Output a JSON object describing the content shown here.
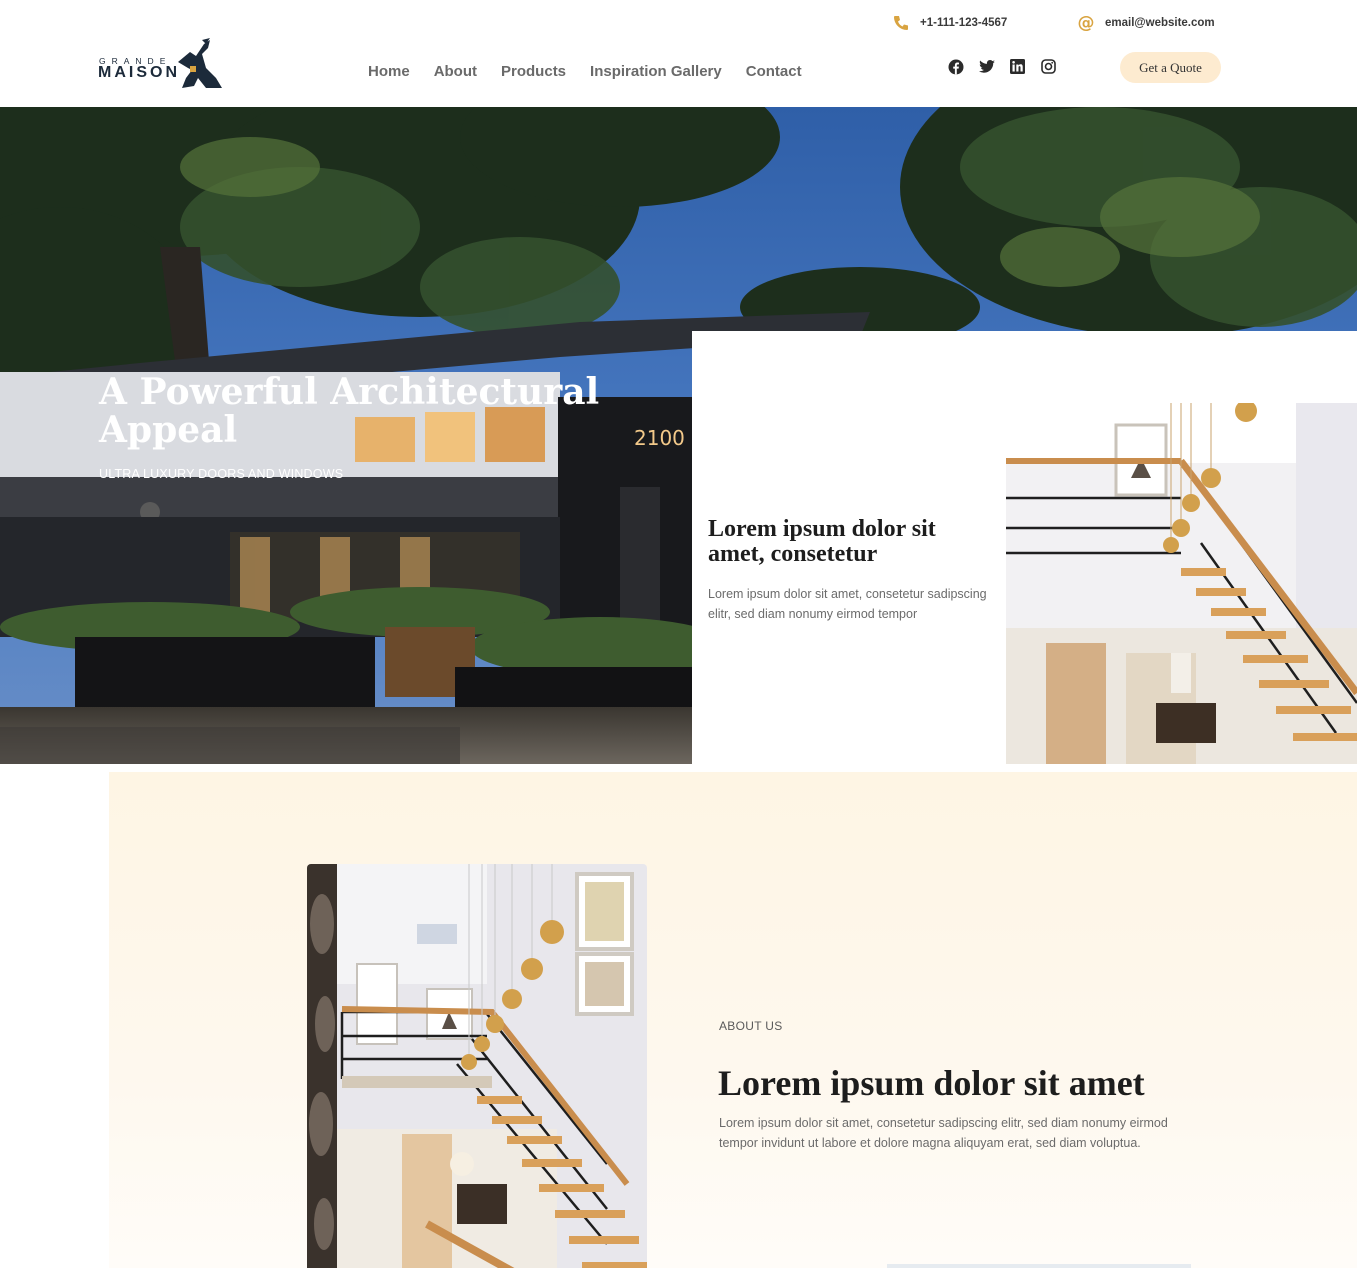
{
  "brand": {
    "logo_top": "GRANDE",
    "logo_main": "MAISON"
  },
  "topbar": {
    "phone": "+1-111-123-4567",
    "email": "email@website.com",
    "phone_icon": "phone-icon",
    "email_icon": "at-icon",
    "accent": "#d9a441"
  },
  "nav": {
    "items": [
      "Home",
      "About",
      "Products",
      "Inspiration Gallery",
      "Contact"
    ]
  },
  "socials": [
    "facebook-icon",
    "twitter-icon",
    "linkedin-icon",
    "instagram-icon"
  ],
  "cta": {
    "label": "Get a Quote",
    "background": "#fdebd0"
  },
  "hero": {
    "title": "A Powerful Architectural Appeal",
    "subtitle": "ULTRA LUXURY DOORS AND WINDOWS",
    "card": {
      "title": "Lorem ipsum dolor sit amet, consetetur",
      "text": "Lorem ipsum dolor sit amet, consetetur sadipscing elitr, sed diam nonumy eirmod tempor"
    }
  },
  "about": {
    "label": "ABOUT US",
    "title": "Lorem ipsum dolor sit amet",
    "text": "Lorem ipsum dolor sit amet, consetetur sadipscing elitr, sed diam nonumy eirmod tempor invidunt ut labore et dolore magna aliquyam erat, sed diam voluptua.",
    "background": "#fef5e4"
  }
}
